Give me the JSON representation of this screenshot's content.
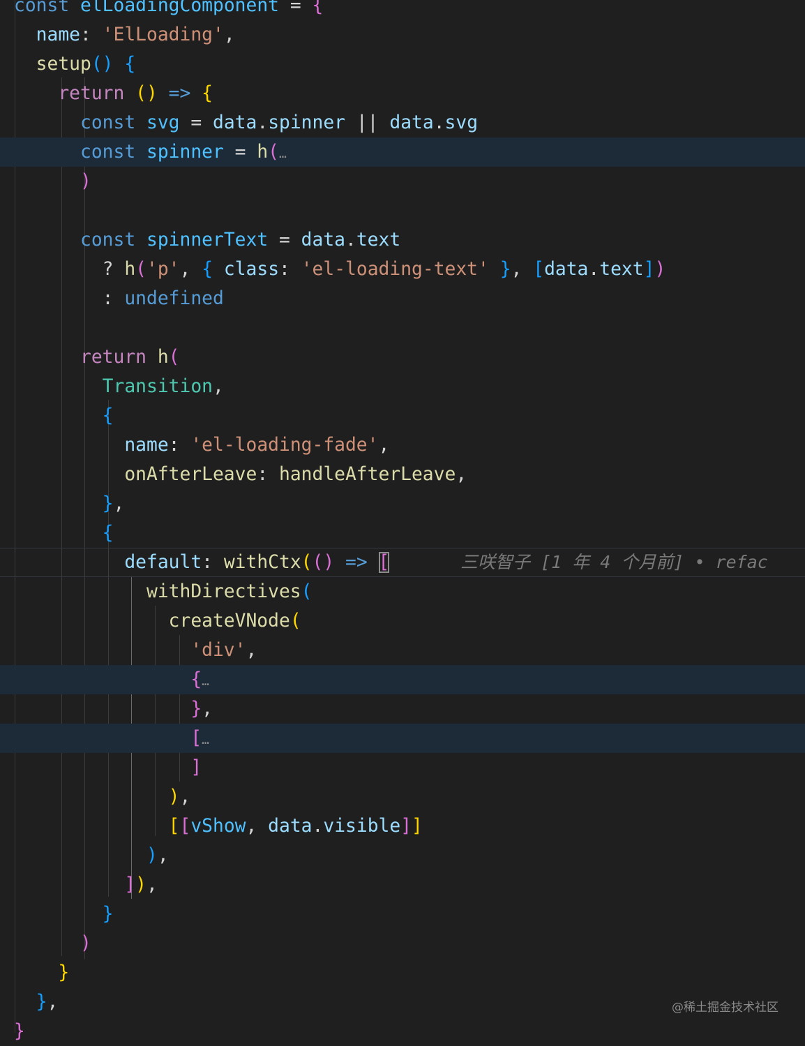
{
  "colors": {
    "background": "#1f1f1f",
    "keyword_blue": "#569cd6",
    "keyword_purple": "#c586c0",
    "variable": "#9cdcfe",
    "constant": "#4fc1ff",
    "function": "#dcdcaa",
    "string": "#ce9178",
    "class": "#4ec9b0",
    "punct": "#d4d4d4",
    "bracket_gold": "#ffd700",
    "bracket_pink": "#da70d6",
    "bracket_blue": "#179fff"
  },
  "blame": "三咲智子 [1 年 4 个月前] • refac",
  "watermark": "@稀土掘金技术社区",
  "code_lines": [
    [
      [
        "const ",
        "keyword_blue"
      ],
      [
        "elLoadingComponent",
        "constant"
      ],
      [
        " = ",
        "punct"
      ],
      [
        "{",
        "bracket_pink"
      ]
    ],
    [
      [
        "  name",
        "variable"
      ],
      [
        ": ",
        "punct"
      ],
      [
        "'ElLoading'",
        "string"
      ],
      [
        ",",
        "punct"
      ]
    ],
    [
      [
        "  setup",
        "function"
      ],
      [
        "()",
        "bracket_blue"
      ],
      [
        " ",
        "punct"
      ],
      [
        "{",
        "bracket_blue"
      ]
    ],
    [
      [
        "    return ",
        "keyword_purple"
      ],
      [
        "()",
        "bracket_gold"
      ],
      [
        " => ",
        "keyword_blue"
      ],
      [
        "{",
        "bracket_gold"
      ]
    ],
    [
      [
        "      const ",
        "keyword_blue"
      ],
      [
        "svg",
        "constant"
      ],
      [
        " = ",
        "punct"
      ],
      [
        "data",
        "variable"
      ],
      [
        ".",
        "punct"
      ],
      [
        "spinner",
        "variable"
      ],
      [
        " || ",
        "punct"
      ],
      [
        "data",
        "variable"
      ],
      [
        ".",
        "punct"
      ],
      [
        "svg",
        "variable"
      ]
    ],
    [
      [
        "      const ",
        "keyword_blue"
      ],
      [
        "spinner",
        "constant"
      ],
      [
        " = ",
        "punct"
      ],
      [
        "h",
        "function"
      ],
      [
        "(",
        "bracket_pink"
      ],
      [
        "…",
        "fold"
      ]
    ],
    [
      [
        "      )",
        "bracket_pink"
      ]
    ],
    [],
    [
      [
        "      const ",
        "keyword_blue"
      ],
      [
        "spinnerText",
        "constant"
      ],
      [
        " = ",
        "punct"
      ],
      [
        "data",
        "variable"
      ],
      [
        ".",
        "punct"
      ],
      [
        "text",
        "variable"
      ]
    ],
    [
      [
        "        ? ",
        "punct"
      ],
      [
        "h",
        "function"
      ],
      [
        "(",
        "bracket_pink"
      ],
      [
        "'p'",
        "string"
      ],
      [
        ", ",
        "punct"
      ],
      [
        "{",
        "bracket_blue"
      ],
      [
        " class",
        "variable"
      ],
      [
        ": ",
        "punct"
      ],
      [
        "'el-loading-text'",
        "string"
      ],
      [
        " ",
        "punct"
      ],
      [
        "}",
        "bracket_blue"
      ],
      [
        ", ",
        "punct"
      ],
      [
        "[",
        "bracket_blue"
      ],
      [
        "data",
        "variable"
      ],
      [
        ".",
        "punct"
      ],
      [
        "text",
        "variable"
      ],
      [
        "]",
        "bracket_blue"
      ],
      [
        ")",
        "bracket_pink"
      ]
    ],
    [
      [
        "        : ",
        "punct"
      ],
      [
        "undefined",
        "keyword_blue"
      ]
    ],
    [],
    [
      [
        "      return ",
        "keyword_purple"
      ],
      [
        "h",
        "function"
      ],
      [
        "(",
        "bracket_pink"
      ]
    ],
    [
      [
        "        Transition",
        "class"
      ],
      [
        ",",
        "punct"
      ]
    ],
    [
      [
        "        {",
        "bracket_blue"
      ]
    ],
    [
      [
        "          name",
        "variable"
      ],
      [
        ": ",
        "punct"
      ],
      [
        "'el-loading-fade'",
        "string"
      ],
      [
        ",",
        "punct"
      ]
    ],
    [
      [
        "          onAfterLeave",
        "function"
      ],
      [
        ": ",
        "punct"
      ],
      [
        "handleAfterLeave",
        "function"
      ],
      [
        ",",
        "punct"
      ]
    ],
    [
      [
        "        }",
        "bracket_blue"
      ],
      [
        ",",
        "punct"
      ]
    ],
    [
      [
        "        {",
        "bracket_blue"
      ]
    ],
    [
      [
        "          default",
        "variable"
      ],
      [
        ": ",
        "punct"
      ],
      [
        "withCtx",
        "function"
      ],
      [
        "(",
        "bracket_gold"
      ],
      [
        "()",
        "bracket_pink"
      ],
      [
        " => ",
        "keyword_blue"
      ],
      [
        "[",
        "bracket_pink"
      ]
    ],
    [
      [
        "            withDirectives",
        "function"
      ],
      [
        "(",
        "bracket_blue"
      ]
    ],
    [
      [
        "              createVNode",
        "function"
      ],
      [
        "(",
        "bracket_gold"
      ]
    ],
    [
      [
        "                'div'",
        "string"
      ],
      [
        ",",
        "punct"
      ]
    ],
    [
      [
        "                {",
        "bracket_pink"
      ],
      [
        "…",
        "fold"
      ]
    ],
    [
      [
        "                }",
        "bracket_pink"
      ],
      [
        ",",
        "punct"
      ]
    ],
    [
      [
        "                [",
        "bracket_pink"
      ],
      [
        "…",
        "fold"
      ]
    ],
    [
      [
        "                ]",
        "bracket_pink"
      ]
    ],
    [
      [
        "              )",
        "bracket_gold"
      ],
      [
        ",",
        "punct"
      ]
    ],
    [
      [
        "              [",
        "bracket_gold"
      ],
      [
        "[",
        "bracket_pink"
      ],
      [
        "vShow",
        "constant"
      ],
      [
        ", ",
        "punct"
      ],
      [
        "data",
        "variable"
      ],
      [
        ".",
        "punct"
      ],
      [
        "visible",
        "variable"
      ],
      [
        "]",
        "bracket_pink"
      ],
      [
        "]",
        "bracket_gold"
      ]
    ],
    [
      [
        "            )",
        "bracket_blue"
      ],
      [
        ",",
        "punct"
      ]
    ],
    [
      [
        "          ]",
        "bracket_pink"
      ],
      [
        ")",
        "bracket_gold"
      ],
      [
        ",",
        "punct"
      ]
    ],
    [
      [
        "        }",
        "bracket_blue"
      ]
    ],
    [
      [
        "      )",
        "bracket_pink"
      ]
    ],
    [
      [
        "    }",
        "bracket_gold"
      ]
    ],
    [
      [
        "  }",
        "bracket_blue"
      ],
      [
        ",",
        "punct"
      ]
    ],
    [
      [
        "}",
        "bracket_pink"
      ]
    ]
  ]
}
